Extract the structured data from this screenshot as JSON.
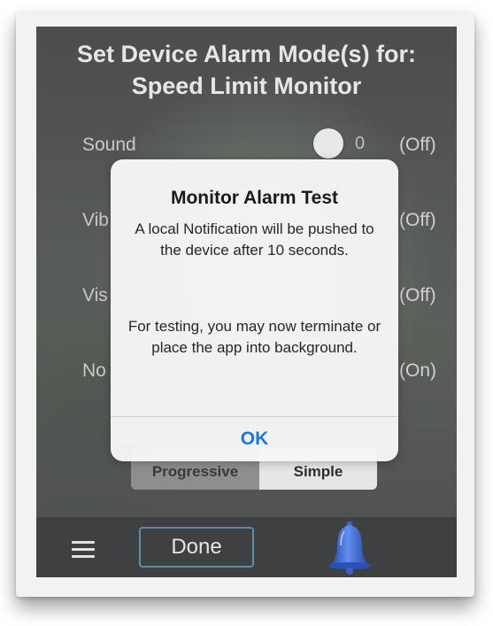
{
  "header": {
    "title_line1": "Set Device Alarm Mode(s) for:",
    "title_line2": "Speed Limit Monitor"
  },
  "settings": {
    "rows": [
      {
        "label": "Sound",
        "value": "0",
        "state": "(Off)"
      },
      {
        "label": "Vib",
        "state": "(Off)"
      },
      {
        "label": "Vis",
        "state": "(Off)"
      },
      {
        "label": "No",
        "state": "(On)"
      }
    ]
  },
  "mode_selector": {
    "options": [
      "Progressive",
      "Simple"
    ],
    "selected": "Simple"
  },
  "alert": {
    "title": "Monitor Alarm Test",
    "message_line1": "A local Notification will be pushed to the device after 10 seconds.",
    "message_line2": "For testing, you may now terminate or place the app into background.",
    "ok_label": "OK"
  },
  "toolbar": {
    "menu_icon": "hamburger-menu-icon",
    "done_label": "Done",
    "bell_icon": "bell-icon"
  },
  "colors": {
    "alert_button": "#1d77d8",
    "done_border": "#5a8ea8",
    "bell": "#2f5fd0"
  }
}
